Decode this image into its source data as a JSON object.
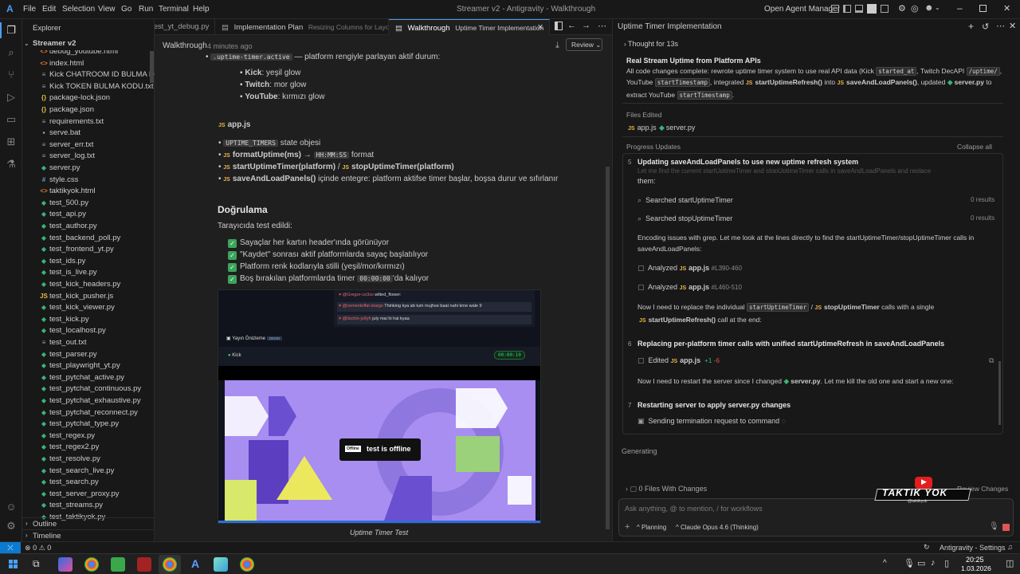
{
  "titlebar": {
    "menus": [
      "File",
      "Edit",
      "Selection",
      "View",
      "Go",
      "Run",
      "Terminal",
      "Help"
    ],
    "title": "Streamer v2 - Antigravity - Walkthrough",
    "agent_manager": "Open Agent Manager"
  },
  "explorer": {
    "header": "Explorer",
    "project": "Streamer v2",
    "files": [
      {
        "name": "debug_youtube.html",
        "type": "html"
      },
      {
        "name": "index.html",
        "type": "html"
      },
      {
        "name": "Kick CHATROOM ID BULMA KO...",
        "type": "txt"
      },
      {
        "name": "Kick TOKEN BULMA KODU.txt",
        "type": "txt"
      },
      {
        "name": "package-lock.json",
        "type": "json"
      },
      {
        "name": "package.json",
        "type": "json"
      },
      {
        "name": "requirements.txt",
        "type": "txt"
      },
      {
        "name": "serve.bat",
        "type": "bat"
      },
      {
        "name": "server_err.txt",
        "type": "txt"
      },
      {
        "name": "server_log.txt",
        "type": "txt"
      },
      {
        "name": "server.py",
        "type": "py"
      },
      {
        "name": "style.css",
        "type": "css"
      },
      {
        "name": "taktikyok.html",
        "type": "html"
      },
      {
        "name": "test_500.py",
        "type": "py"
      },
      {
        "name": "test_api.py",
        "type": "py"
      },
      {
        "name": "test_author.py",
        "type": "py"
      },
      {
        "name": "test_backend_poll.py",
        "type": "py"
      },
      {
        "name": "test_frontend_yt.py",
        "type": "py"
      },
      {
        "name": "test_ids.py",
        "type": "py"
      },
      {
        "name": "test_is_live.py",
        "type": "py"
      },
      {
        "name": "test_kick_headers.py",
        "type": "py"
      },
      {
        "name": "test_kick_pusher.js",
        "type": "js"
      },
      {
        "name": "test_kick_viewer.py",
        "type": "py"
      },
      {
        "name": "test_kick.py",
        "type": "py"
      },
      {
        "name": "test_localhost.py",
        "type": "py"
      },
      {
        "name": "test_out.txt",
        "type": "txt"
      },
      {
        "name": "test_parser.py",
        "type": "py"
      },
      {
        "name": "test_playwright_yt.py",
        "type": "py"
      },
      {
        "name": "test_pytchat_active.py",
        "type": "py"
      },
      {
        "name": "test_pytchat_continuous.py",
        "type": "py"
      },
      {
        "name": "test_pytchat_exhaustive.py",
        "type": "py"
      },
      {
        "name": "test_pytchat_reconnect.py",
        "type": "py"
      },
      {
        "name": "test_pytchat_type.py",
        "type": "py"
      },
      {
        "name": "test_regex.py",
        "type": "py"
      },
      {
        "name": "test_regex2.py",
        "type": "py"
      },
      {
        "name": "test_resolve.py",
        "type": "py"
      },
      {
        "name": "test_search_live.py",
        "type": "py"
      },
      {
        "name": "test_search.py",
        "type": "py"
      },
      {
        "name": "test_server_proxy.py",
        "type": "py"
      },
      {
        "name": "test_streams.py",
        "type": "py"
      },
      {
        "name": "test_taktikyok.py",
        "type": "py"
      }
    ],
    "outline": "Outline",
    "timeline": "Timeline"
  },
  "tabs": [
    {
      "label": "test_yt_debug.py",
      "sub": ""
    },
    {
      "label": "Implementation Plan",
      "sub": "Resizing Columns for Layout"
    },
    {
      "label": "Walkthrough",
      "sub": "Uptime Timer Implementation"
    }
  ],
  "editor": {
    "breadcrumb": "Walkthrough",
    "time": "4 minutes ago",
    "review": "Review",
    "uptime_line_code": ".uptime-timer.active",
    "uptime_line_text": "— platform rengiyle parlayan aktif durum:",
    "platforms": [
      {
        "name": "Kick",
        "desc": ": yeşil glow"
      },
      {
        "name": "Twitch",
        "desc": ": mor glow"
      },
      {
        "name": "YouTube",
        "desc": ": kırmızı glow"
      }
    ],
    "appjs": "app.js",
    "items": [
      {
        "code": "UPTIME_TIMERS",
        "text": "state objesi"
      },
      {
        "fn": "formatUptime(ms)",
        "arrow": "→",
        "code": "HH:MM:SS",
        "text": "format"
      },
      {
        "fn": "startUptimeTimer(platform)",
        "sep": "/",
        "fn2": "stopUptimeTimer(platform)"
      },
      {
        "fn": "saveAndLoadPanels()",
        "text": "içinde entegre: platform aktifse timer başlar, boşsa durur ve sıfırlanır"
      }
    ],
    "heading": "Doğrulama",
    "intro": "Tarayıcıda test edildi:",
    "checks": [
      {
        "text": "Sayaçlar her kartın header'ında görünüyor"
      },
      {
        "text": "\"Kaydet\" sonrası aktif platformlarda sayaç başlatılıyor"
      },
      {
        "text": "Platform renk kodlarıyla stilli (yeşil/mor/kırmızı)"
      },
      {
        "text": "Boş bırakılan platformlarda timer",
        "code": "00:00:00",
        "after": "'da kalıyor"
      }
    ],
    "shot": {
      "chat": [
        {
          "user": "@Gregor-ce3ss",
          "msg": "wilted_flower:"
        },
        {
          "user": "@cementoffal-stargo",
          "msg": "Thinking kya ab tum mujhse baat nahi krne wale 9"
        },
        {
          "user": "@lischin-jo9yh",
          "msg": "july mai hi hai kyaa"
        }
      ],
      "preview": "Yayın Önizleme",
      "preview_badge": "DEMO",
      "kick": "Kick",
      "timer": "00:00:10",
      "offline_tag": "Offline",
      "offline": "test is offline"
    },
    "caption": "Uptime Timer Test"
  },
  "chat": {
    "title": "Uptime Timer Implementation",
    "thought": "Thought for 13s",
    "heading": "Real Stream Uptime from Platform APIs",
    "p1a": "All code changes complete: rewrote uptime timer system to use real API data (Kick",
    "c1": "started_at",
    "p1b": ", Twitch DecAPI",
    "c2": "/uptime/",
    "p2a": "YouTube",
    "c3": "startTimestamp",
    "p2b": ", integrated",
    "f1": "startUptimeRefresh()",
    "p2c": "into",
    "f2": "saveAndLoadPanels()",
    "p2d": ", updated",
    "f3": "server.py",
    "p2e": "to",
    "p3a": "extract YouTube",
    "c4": "startTimestamp",
    "p3b": ".",
    "files_edited": "Files Edited",
    "file1": "app.js",
    "file2": "server.py",
    "progress": "Progress Updates",
    "collapse": "Collapse all",
    "s5num": "5",
    "s5": "Updating saveAndLoadPanels to use new uptime refresh system",
    "s5clip": "Let me find the current startUptimeTimer and stopUptimeTimer calls in saveAndLoadPanels and replace",
    "them": "them:",
    "searched": [
      {
        "label": "Searched startUptimeTimer",
        "res": "0 results"
      },
      {
        "label": "Searched stopUptimeTimer",
        "res": "0 results"
      }
    ],
    "enc1": "Encoding issues with grep. Let me look at the lines directly to find the startUptimeTimer/stopUptimeTimer calls in",
    "enc2": "saveAndLoadPanels:",
    "analyzed": [
      {
        "label": "Analyzed",
        "file": "app.js",
        "range": "#L390-460"
      },
      {
        "label": "Analyzed",
        "file": "app.js",
        "range": "#L460-510"
      }
    ],
    "need1": "Now I need to replace the individual",
    "need_c": "startUptimeTimer",
    "need_sep": "/",
    "need_f": "stopUptimeTimer",
    "need2": "calls with a single",
    "need_f2": "startUptimeRefresh()",
    "need3": "call at the end:",
    "s6num": "6",
    "s6": "Replacing per-platform timer calls with unified startUptimeRefresh in saveAndLoadPanels",
    "edited": "Edited",
    "edited_file": "app.js",
    "added": "+1",
    "removed": "-6",
    "restart1": "Now I need to restart the server since I changed",
    "restart_f": "server.py",
    "restart2": ". Let me kill the old one and start a new one:",
    "s7num": "7",
    "s7": "Restarting server to apply server.py changes",
    "sending": "Sending termination request to command",
    "generating": "Generating",
    "changes": "0 Files With Changes",
    "review_changes": "Review Changes",
    "input_placeholder": "Ask anything, @ to mention, / for workflows",
    "planning": "Planning",
    "model": "Claude Opus 4.6 (Thinking)"
  },
  "watermark": {
    "text": "TAKTIK YOK",
    "handle": "@taktikyok"
  },
  "status": {
    "errors": "0",
    "warnings": "0",
    "settings": "Antigravity - Settings"
  },
  "taskbar": {
    "time": "20:25",
    "date": "1.03.2026"
  }
}
